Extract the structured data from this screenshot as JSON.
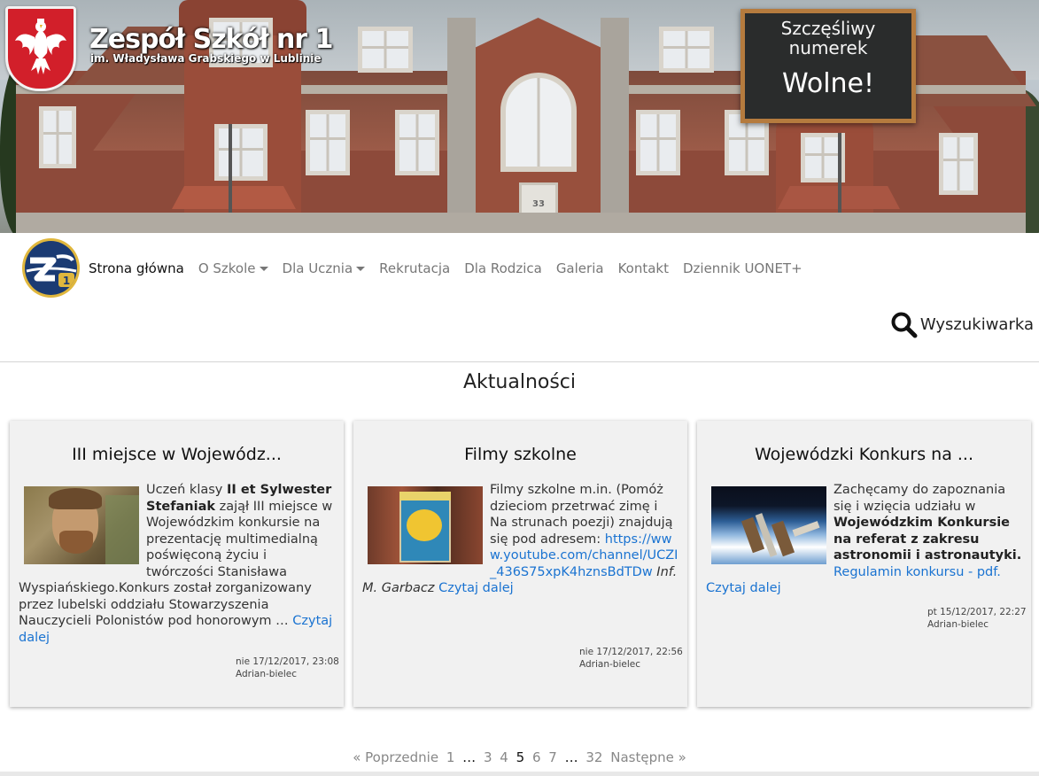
{
  "header": {
    "school_name": "Zespół Szkół nr 1",
    "school_subtitle": "im. Władysława Grabskiego w Lublinie",
    "chalkboard": {
      "line1": "Szczęśliwy",
      "line2": "numerek",
      "value": "Wolne!"
    },
    "building_plaque": "33"
  },
  "nav": {
    "items": [
      {
        "label": "Strona główna",
        "active": true,
        "dropdown": false
      },
      {
        "label": "O Szkole",
        "active": false,
        "dropdown": true
      },
      {
        "label": "Dla Ucznia",
        "active": false,
        "dropdown": true
      },
      {
        "label": "Rekrutacja",
        "active": false,
        "dropdown": false
      },
      {
        "label": "Dla Rodzica",
        "active": false,
        "dropdown": false
      },
      {
        "label": "Galeria",
        "active": false,
        "dropdown": false
      },
      {
        "label": "Kontakt",
        "active": false,
        "dropdown": false
      },
      {
        "label": "Dziennik UONET+",
        "active": false,
        "dropdown": false
      }
    ],
    "search_label": "Wyszukiwarka"
  },
  "news": {
    "title": "Aktualności",
    "read_more": "Czytaj dalej",
    "cards": [
      {
        "title": "III miejsce w Wojewódz...",
        "body": {
          "t1": "Uczeń klasy ",
          "b1": "II et Sylwester Stefaniak",
          "t2": " zajął III miejsce w Wojewódzkim konkursie na prezentację multimedialną poświęconą życiu i twórczości Stanisława Wyspiańskiego.Konkurs  został zorganizowany przez lubelski oddziału Stowarzyszenia Nauczycieli Polonistów pod honorowym … "
        },
        "date": "nie 17/12/2017, 23:08",
        "author": "Adrian-bielec"
      },
      {
        "title": "Filmy szkolne",
        "body": {
          "t1": "Filmy szkolne m.in. (Pomóż dzieciom przetrwać zimę i Na strunach poezji) znajdują się pod adresem: ",
          "link": "https://www.youtube.com/channel/UCZI_436S75xpK4hznsBdTDw",
          "t2": " ",
          "italic": "Inf. M. Garbacz"
        },
        "date": "nie 17/12/2017, 22:56",
        "author": "Adrian-bielec"
      },
      {
        "title": "Wojewódzki Konkurs na ...",
        "body": {
          "t1": "Zachęcamy do zapoznania się i wzięcia udziału w ",
          "b1": "Wojewódzkim Konkursie na referat z zakresu astronomii i astronautyki.",
          "t2": " ",
          "link": "Regulamin konkursu - pdf."
        },
        "date": "pt 15/12/2017, 22:27",
        "author": "Adrian-bielec"
      }
    ]
  },
  "pagination": {
    "prev": "« Poprzednie",
    "pages_a": [
      "1"
    ],
    "dots": "…",
    "pages_b": [
      "3",
      "4",
      "5",
      "6",
      "7"
    ],
    "current": "5",
    "last": "32",
    "next": "Następne »"
  },
  "colors": {
    "link": "#1a73d1",
    "emblem_red": "#d21f2a",
    "logo_blue": "#1b3b73",
    "logo_gold": "#e0b73d",
    "frame_wood": "#b57b3e"
  }
}
